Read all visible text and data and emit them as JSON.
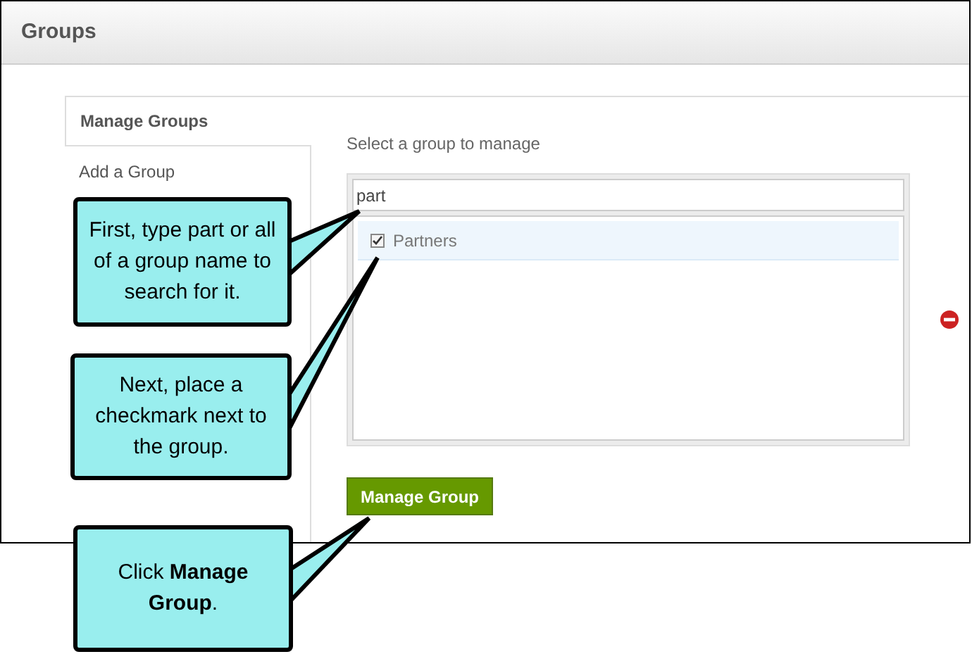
{
  "header": {
    "title": "Groups"
  },
  "tabs": [
    {
      "label": "Manage Groups",
      "selected": true
    },
    {
      "label": "Add a Group",
      "selected": false
    }
  ],
  "panel": {
    "instruction": "Select a group to manage",
    "search": {
      "value": "part"
    },
    "groups": [
      {
        "label": "Partners",
        "checked": true,
        "selected": true
      }
    ],
    "button": "Manage Group"
  },
  "callouts": [
    {
      "text": "First, type part or all of a group name to search for it."
    },
    {
      "text": "Next, place a checkmark next to the group."
    },
    {
      "text": "Click **Manage Group**."
    }
  ]
}
